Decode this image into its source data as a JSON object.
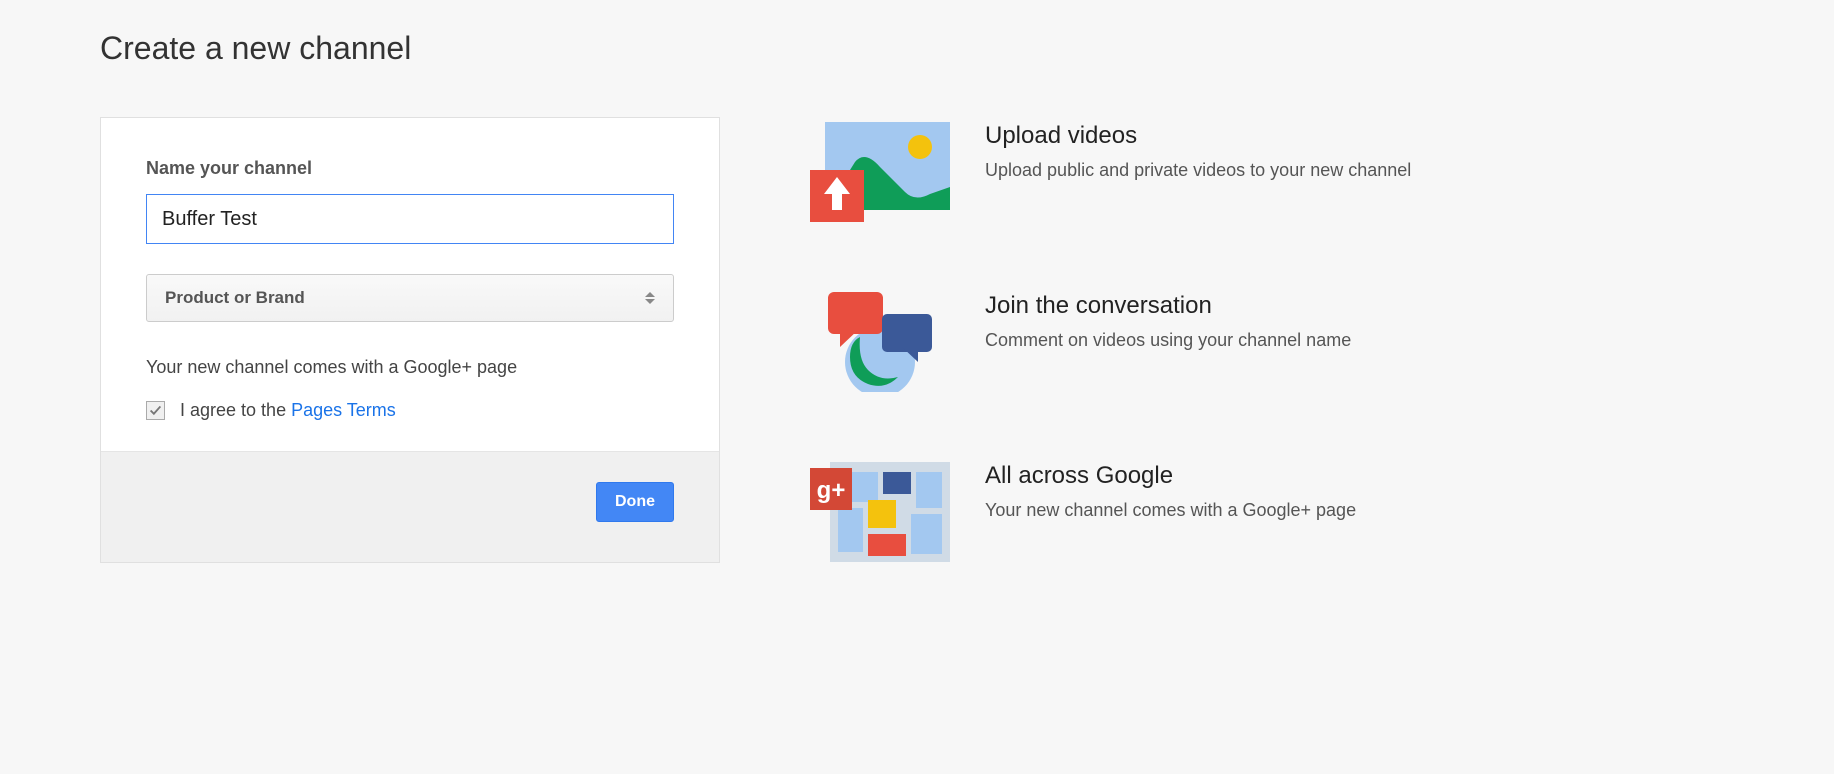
{
  "page": {
    "title": "Create a new channel"
  },
  "form": {
    "name_label": "Name your channel",
    "name_value": "Buffer Test",
    "category_selected": "Product or Brand",
    "info_text": "Your new channel comes with a Google+ page",
    "agree_prefix": "I agree to the ",
    "terms_link": "Pages Terms",
    "done_button": "Done"
  },
  "features": [
    {
      "title": "Upload videos",
      "description": "Upload public and private videos to your new channel"
    },
    {
      "title": "Join the conversation",
      "description": "Comment on videos using your channel name"
    },
    {
      "title": "All across Google",
      "description": "Your new channel comes with a Google+ page"
    }
  ]
}
